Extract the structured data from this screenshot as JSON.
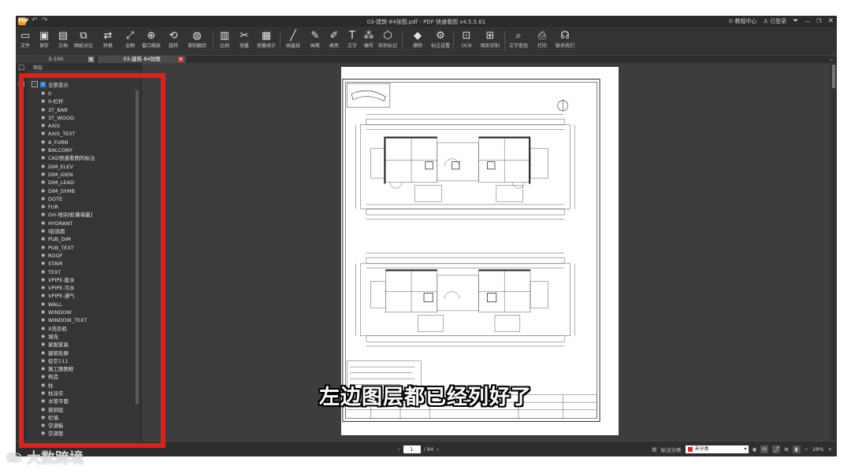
{
  "titlebar": {
    "app_icon_text": "PDF",
    "undo_icon": "undo-icon",
    "redo_icon": "redo-icon",
    "title": "03-建筑-84张图.pdf - PDF 快速看图 v4.5.5.61",
    "help": "⊙ 教程中心",
    "user": "♙ 已登录",
    "win_controls": [
      "menu-icon",
      "minimize-icon",
      "restore-icon",
      "close-icon"
    ]
  },
  "toolbar": [
    {
      "label": "文件",
      "icon": "folder-icon"
    },
    {
      "label": "保存",
      "icon": "save-icon"
    },
    {
      "label": "文档",
      "icon": "document-icon"
    },
    {
      "label": "图纸对比",
      "icon": "compare-icon"
    },
    {
      "label": "转换",
      "icon": "convert-icon"
    },
    {
      "label": "全图",
      "icon": "fit-all-icon"
    },
    {
      "label": "窗口缩放",
      "icon": "zoom-window-icon"
    },
    {
      "label": "旋转",
      "icon": "rotate-icon"
    },
    {
      "label": "滚轮翻页",
      "icon": "mouse-wheel-icon"
    },
    {
      "label": "比例",
      "icon": "scale-icon"
    },
    {
      "label": "测量",
      "icon": "measure-icon"
    },
    {
      "label": "测量统计",
      "icon": "measure-stats-icon"
    },
    {
      "label": "画直线",
      "icon": "line-icon"
    },
    {
      "label": "画笔",
      "icon": "pen-icon"
    },
    {
      "label": "高亮",
      "icon": "highlight-icon"
    },
    {
      "label": "文字",
      "icon": "text-icon"
    },
    {
      "label": "编号",
      "icon": "number-icon"
    },
    {
      "label": "形状标记",
      "icon": "shape-mark-icon"
    },
    {
      "label": "擦除",
      "icon": "eraser-icon"
    },
    {
      "label": "标注设置",
      "icon": "annotation-settings-icon"
    },
    {
      "label": "OCR",
      "icon": "ocr-icon"
    },
    {
      "label": "图形识别",
      "icon": "shape-recognize-icon"
    },
    {
      "label": "文字查找",
      "icon": "search-icon"
    },
    {
      "label": "打印",
      "icon": "print-icon"
    },
    {
      "label": "联系我们",
      "icon": "headset-icon"
    }
  ],
  "tabs": [
    {
      "label": "S-100",
      "active": false
    },
    {
      "label": "03-建筑-84张图",
      "active": true
    }
  ],
  "panel": {
    "title": "图层",
    "show_all_label": "全部显示",
    "layers": [
      "0",
      "0-栏杆",
      "3T_BAR",
      "3T_WOOD",
      "AXIS",
      "AXIS_TEXT",
      "A_FURN",
      "BALCONY",
      "CAD快速看图的标注",
      "DIM_ELEV",
      "DIM_IDEN",
      "DIM_LEAD",
      "DIM_SYMB",
      "DOTE",
      "FUR",
      "GH-地块线[幕墙量]",
      "HYDRANT",
      "I层选面",
      "PUB_DIM",
      "PUB_TEXT",
      "ROOF",
      "STAIR",
      "TEXT",
      "VPIPE-废水",
      "VPIPE-污水",
      "VPIPE-通气",
      "WALL",
      "WINDOW",
      "WINDOW_TEXT",
      "X洗衣机",
      "填充",
      "家配家具",
      "建筑轮廓",
      "挖空111",
      "施工图图框",
      "构造",
      "柱",
      "柱涂实",
      "水管平面",
      "窗洞层",
      "栏墙",
      "空调板",
      "空调管"
    ]
  },
  "status": {
    "page_current": "1",
    "page_total": "/ 84",
    "annotation_label": "标注分类",
    "category": "未分类",
    "zoom": "28%"
  },
  "subtitle": "左边图层都已经列好了",
  "watermark": "大数跨境",
  "colors": {
    "accent_red": "#e0201c",
    "checkbox_blue": "#2f7fe0"
  }
}
